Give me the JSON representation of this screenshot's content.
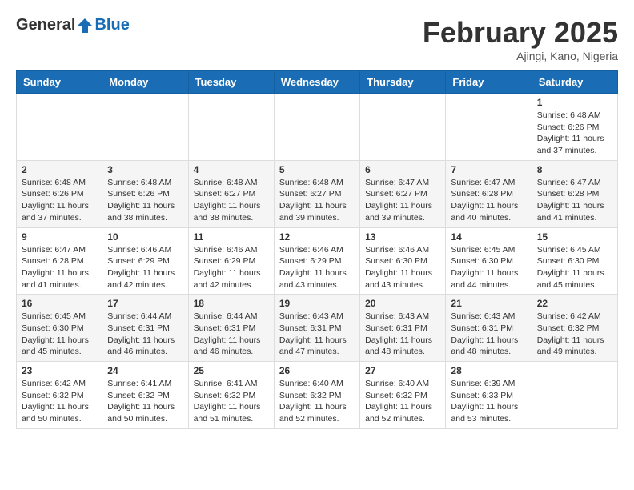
{
  "header": {
    "logo_general": "General",
    "logo_blue": "Blue",
    "month_title": "February 2025",
    "location": "Ajingi, Kano, Nigeria"
  },
  "weekdays": [
    "Sunday",
    "Monday",
    "Tuesday",
    "Wednesday",
    "Thursday",
    "Friday",
    "Saturday"
  ],
  "weeks": [
    [
      {
        "day": "",
        "info": ""
      },
      {
        "day": "",
        "info": ""
      },
      {
        "day": "",
        "info": ""
      },
      {
        "day": "",
        "info": ""
      },
      {
        "day": "",
        "info": ""
      },
      {
        "day": "",
        "info": ""
      },
      {
        "day": "1",
        "info": "Sunrise: 6:48 AM\nSunset: 6:26 PM\nDaylight: 11 hours and 37 minutes."
      }
    ],
    [
      {
        "day": "2",
        "info": "Sunrise: 6:48 AM\nSunset: 6:26 PM\nDaylight: 11 hours and 37 minutes."
      },
      {
        "day": "3",
        "info": "Sunrise: 6:48 AM\nSunset: 6:26 PM\nDaylight: 11 hours and 38 minutes."
      },
      {
        "day": "4",
        "info": "Sunrise: 6:48 AM\nSunset: 6:27 PM\nDaylight: 11 hours and 38 minutes."
      },
      {
        "day": "5",
        "info": "Sunrise: 6:48 AM\nSunset: 6:27 PM\nDaylight: 11 hours and 39 minutes."
      },
      {
        "day": "6",
        "info": "Sunrise: 6:47 AM\nSunset: 6:27 PM\nDaylight: 11 hours and 39 minutes."
      },
      {
        "day": "7",
        "info": "Sunrise: 6:47 AM\nSunset: 6:28 PM\nDaylight: 11 hours and 40 minutes."
      },
      {
        "day": "8",
        "info": "Sunrise: 6:47 AM\nSunset: 6:28 PM\nDaylight: 11 hours and 41 minutes."
      }
    ],
    [
      {
        "day": "9",
        "info": "Sunrise: 6:47 AM\nSunset: 6:28 PM\nDaylight: 11 hours and 41 minutes."
      },
      {
        "day": "10",
        "info": "Sunrise: 6:46 AM\nSunset: 6:29 PM\nDaylight: 11 hours and 42 minutes."
      },
      {
        "day": "11",
        "info": "Sunrise: 6:46 AM\nSunset: 6:29 PM\nDaylight: 11 hours and 42 minutes."
      },
      {
        "day": "12",
        "info": "Sunrise: 6:46 AM\nSunset: 6:29 PM\nDaylight: 11 hours and 43 minutes."
      },
      {
        "day": "13",
        "info": "Sunrise: 6:46 AM\nSunset: 6:30 PM\nDaylight: 11 hours and 43 minutes."
      },
      {
        "day": "14",
        "info": "Sunrise: 6:45 AM\nSunset: 6:30 PM\nDaylight: 11 hours and 44 minutes."
      },
      {
        "day": "15",
        "info": "Sunrise: 6:45 AM\nSunset: 6:30 PM\nDaylight: 11 hours and 45 minutes."
      }
    ],
    [
      {
        "day": "16",
        "info": "Sunrise: 6:45 AM\nSunset: 6:30 PM\nDaylight: 11 hours and 45 minutes."
      },
      {
        "day": "17",
        "info": "Sunrise: 6:44 AM\nSunset: 6:31 PM\nDaylight: 11 hours and 46 minutes."
      },
      {
        "day": "18",
        "info": "Sunrise: 6:44 AM\nSunset: 6:31 PM\nDaylight: 11 hours and 46 minutes."
      },
      {
        "day": "19",
        "info": "Sunrise: 6:43 AM\nSunset: 6:31 PM\nDaylight: 11 hours and 47 minutes."
      },
      {
        "day": "20",
        "info": "Sunrise: 6:43 AM\nSunset: 6:31 PM\nDaylight: 11 hours and 48 minutes."
      },
      {
        "day": "21",
        "info": "Sunrise: 6:43 AM\nSunset: 6:31 PM\nDaylight: 11 hours and 48 minutes."
      },
      {
        "day": "22",
        "info": "Sunrise: 6:42 AM\nSunset: 6:32 PM\nDaylight: 11 hours and 49 minutes."
      }
    ],
    [
      {
        "day": "23",
        "info": "Sunrise: 6:42 AM\nSunset: 6:32 PM\nDaylight: 11 hours and 50 minutes."
      },
      {
        "day": "24",
        "info": "Sunrise: 6:41 AM\nSunset: 6:32 PM\nDaylight: 11 hours and 50 minutes."
      },
      {
        "day": "25",
        "info": "Sunrise: 6:41 AM\nSunset: 6:32 PM\nDaylight: 11 hours and 51 minutes."
      },
      {
        "day": "26",
        "info": "Sunrise: 6:40 AM\nSunset: 6:32 PM\nDaylight: 11 hours and 52 minutes."
      },
      {
        "day": "27",
        "info": "Sunrise: 6:40 AM\nSunset: 6:32 PM\nDaylight: 11 hours and 52 minutes."
      },
      {
        "day": "28",
        "info": "Sunrise: 6:39 AM\nSunset: 6:33 PM\nDaylight: 11 hours and 53 minutes."
      },
      {
        "day": "",
        "info": ""
      }
    ]
  ]
}
